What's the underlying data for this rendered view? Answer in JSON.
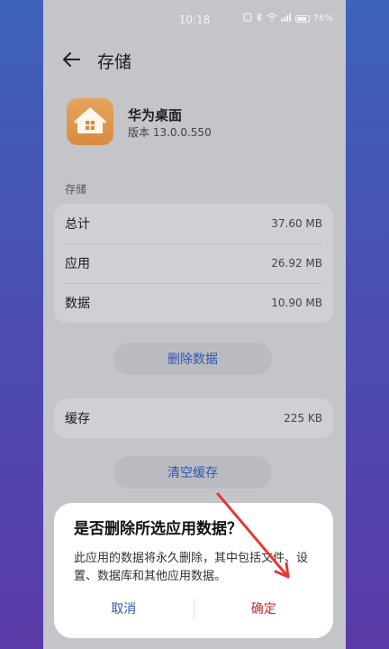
{
  "status": {
    "time": "10:18",
    "battery": "76%"
  },
  "header": {
    "title": "存储"
  },
  "app": {
    "name": "华为桌面",
    "version": "版本 13.0.0.550"
  },
  "storage": {
    "section_label": "存储",
    "rows": [
      {
        "label": "总计",
        "value": "37.60 MB"
      },
      {
        "label": "应用",
        "value": "26.92 MB"
      },
      {
        "label": "数据",
        "value": "10.90 MB"
      }
    ],
    "delete_button": "删除数据"
  },
  "cache": {
    "label": "缓存",
    "value": "225 KB",
    "clear_button": "清空缓存"
  },
  "dialog": {
    "title": "是否删除所选应用数据？",
    "message": "此应用的数据将永久删除，其中包括文件、设置、数据库和其他应用数据。",
    "cancel": "取消",
    "confirm": "确定"
  },
  "colors": {
    "accent": "#2f56b5",
    "danger": "#c62828"
  }
}
